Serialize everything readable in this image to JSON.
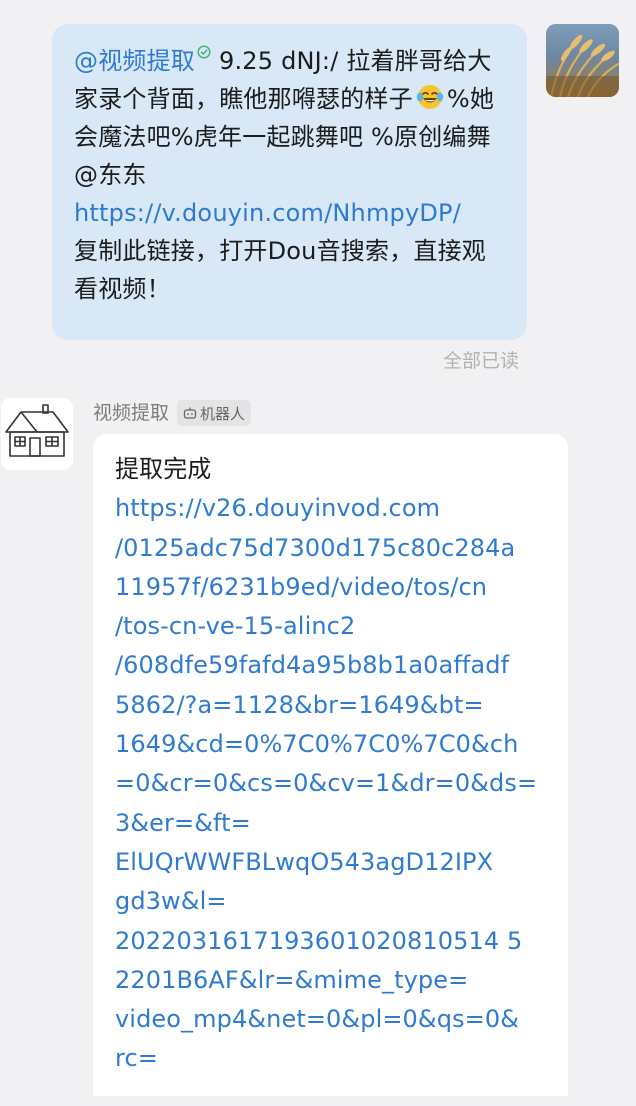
{
  "outgoing_message": {
    "mention": "@视频提取",
    "after_mention": "9.25 dNJ:/ 拉着胖哥给大家录个背面，瞧他那嘚瑟的样子",
    "after_emoji": "%她会魔法吧%虎年一起跳舞吧 %原创编舞@东东",
    "link": "https://v.douyin.com/NhmpyDP/",
    "tail": "复制此链接，打开Dou音搜索，直接观看视频！",
    "read_status": "全部已读",
    "verified_icon": "check-circle-icon",
    "emoji_icon": "tears-of-joy-emoji"
  },
  "incoming_message": {
    "sender": "视频提取",
    "badge": "机器人",
    "badge_icon": "robot-icon",
    "title": "提取完成",
    "link_lines": [
      "https://v26.douyinvod.com",
      "/0125adc75d7300d175c80c284a",
      "11957f/6231b9ed/video/tos/cn",
      "/tos-cn-ve-15-alinc2",
      "/608dfe59fafd4a95b8b1a0affadf",
      "5862/?a=1128&br=1649&bt=",
      "1649&cd=0%7C0%7C0%7C0&ch",
      "=0&cr=0&cs=0&cv=1&dr=0&ds=",
      "3&er=&ft=",
      "ElUQrWWFBLwqO543agD12IPX",
      "gd3w&l=",
      "2022031617193601020810514 5",
      "2201B6AF&lr=&mime_type=",
      "video_mp4&net=0&pl=0&qs=0&",
      "rc="
    ]
  },
  "colors": {
    "background": "#f1f1f3",
    "outgoing_bubble": "#d8e8f7",
    "incoming_bubble": "#ffffff",
    "link": "#2e7bcf",
    "text": "#1c1c1c",
    "muted": "#b2b2b2"
  }
}
